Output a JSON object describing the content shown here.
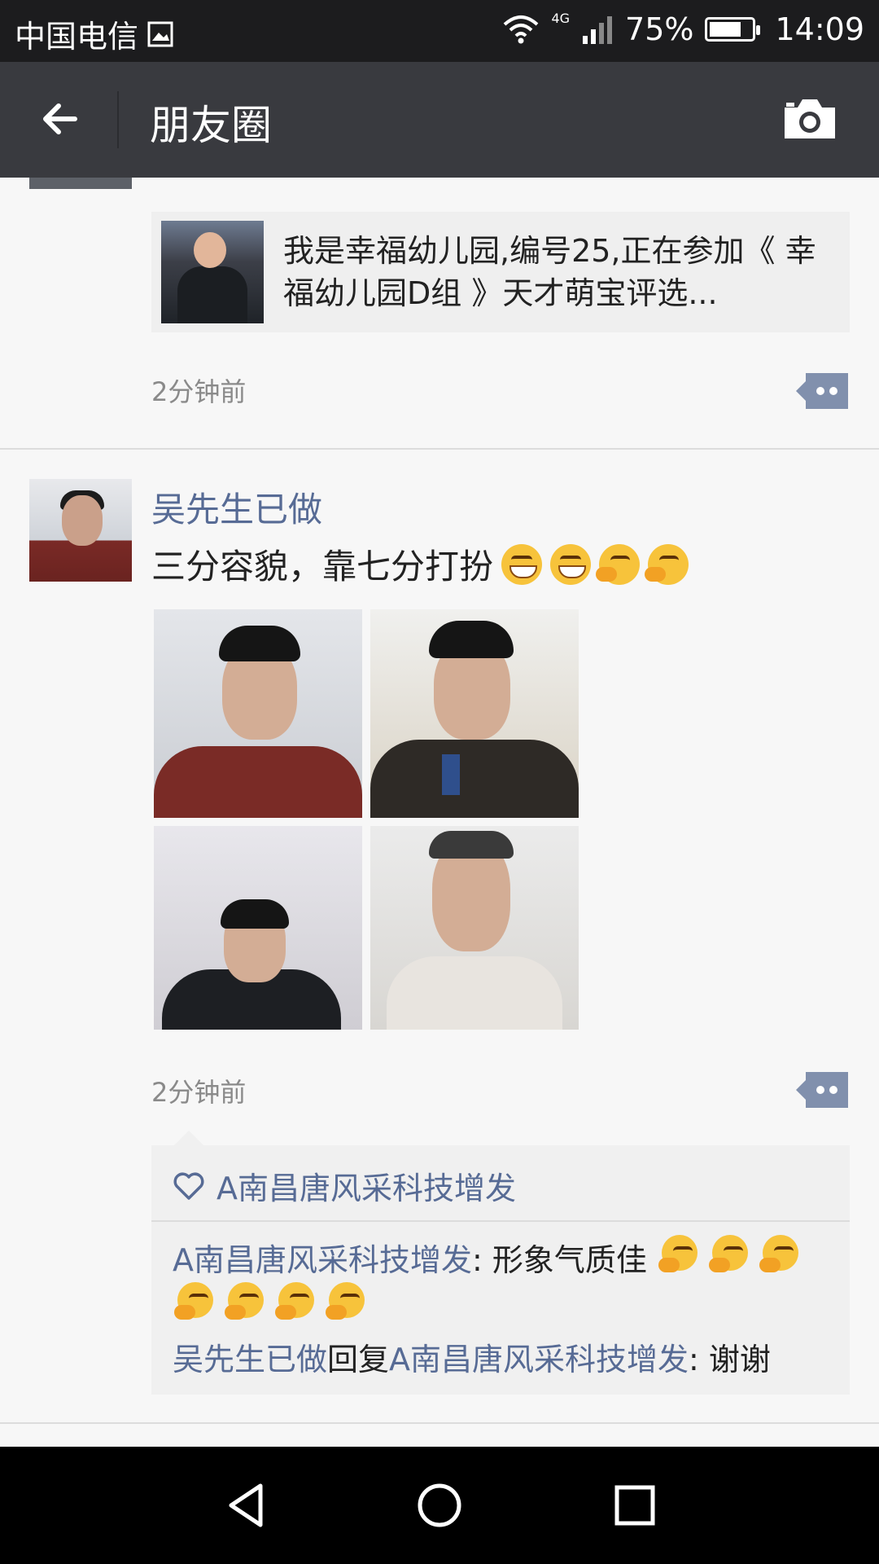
{
  "status_bar": {
    "carrier": "中国电信",
    "network": "4G",
    "battery_percent": "75%",
    "battery_level": 0.75,
    "time": "14:09"
  },
  "nav": {
    "title": "朋友圈",
    "back_icon": "back-arrow-icon",
    "camera_icon": "camera-icon"
  },
  "prev_post": {
    "link_card_text": "我是幸福幼儿园,编号25,正在参加《 幸福幼儿园D组 》天才萌宝评选...",
    "time": "2分钟前"
  },
  "post": {
    "username": "吴先生已做",
    "text": "三分容貌，靠七分打扮",
    "emojis": [
      "grin",
      "grin",
      "think",
      "think"
    ],
    "photo_count": 4,
    "time": "2分钟前",
    "likes": {
      "icon": "heart-outline-icon",
      "names": "A南昌唐风采科技增发"
    },
    "comments": [
      {
        "author": "A南昌唐风采科技增发",
        "reply_to": "",
        "reply_word": "",
        "text": "形象气质佳",
        "emoji_count": 7
      },
      {
        "author": "吴先生已做",
        "reply_word": "回复",
        "reply_to": "A南昌唐风采科技增发",
        "text": "谢谢",
        "emoji_count": 0
      }
    ]
  },
  "colors": {
    "nav_bg": "#393a3f",
    "link_name": "#576b95",
    "page_bg": "#f7f7f7"
  }
}
